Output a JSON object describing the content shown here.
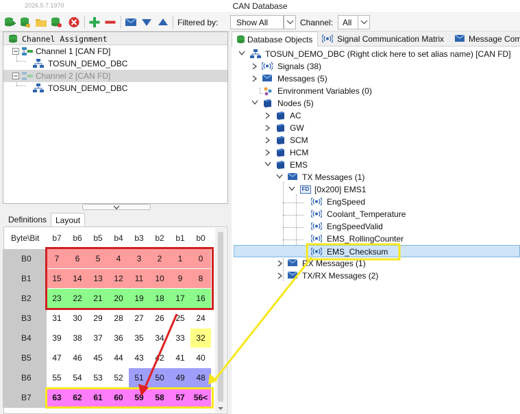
{
  "window": {
    "version": "2026.5.7.1970",
    "title": "CAN Database"
  },
  "toolbar": {
    "filtered_by_label": "Filtered by:",
    "filter_value": "Show All",
    "channel_label": "Channel:",
    "channel_value": "All",
    "icons": [
      "add-database-icon",
      "database-icon",
      "open-folder-icon",
      "delete-icon",
      "add-icon",
      "remove-icon",
      "message-icon",
      "move-down-icon",
      "move-up-icon"
    ]
  },
  "channel_assignment": {
    "header": "Channel Assignment",
    "items": [
      {
        "label": "Channel 1 [CAN FD]",
        "child": "TOSUN_DEMO_DBC"
      },
      {
        "label": "Channel 2 [CAN FD]",
        "child": "TOSUN_DEMO_DBC"
      }
    ]
  },
  "left_tabs": {
    "definitions": "Definitions",
    "layout": "Layout"
  },
  "layout_grid": {
    "corner": "Byte\\Bit",
    "bit_headers": [
      "b7",
      "b6",
      "b5",
      "b4",
      "b3",
      "b2",
      "b1",
      "b0"
    ],
    "rows": [
      {
        "label": "B0",
        "cells": [
          "7",
          "6",
          "5",
          "4",
          "3",
          "2",
          "1",
          "0"
        ]
      },
      {
        "label": "B1",
        "cells": [
          "15",
          "14",
          "13",
          "12",
          "11",
          "10",
          "9",
          "8"
        ]
      },
      {
        "label": "B2",
        "cells": [
          "23",
          "22",
          "21",
          "20",
          "19",
          "18",
          "17",
          "16"
        ]
      },
      {
        "label": "B3",
        "cells": [
          "31",
          "30",
          "29",
          "28",
          "27",
          "26",
          "25",
          "24"
        ]
      },
      {
        "label": "B4",
        "cells": [
          "39",
          "38",
          "37",
          "36",
          "35",
          "34",
          "33",
          "32"
        ]
      },
      {
        "label": "B5",
        "cells": [
          "47",
          "46",
          "45",
          "44",
          "43",
          "42",
          "41",
          "40"
        ]
      },
      {
        "label": "B6",
        "cells": [
          "55",
          "54",
          "53",
          "52",
          "51",
          "50",
          "49",
          "48"
        ]
      },
      {
        "label": "B7",
        "cells": [
          "63",
          "62",
          "61",
          "60",
          "59",
          "58",
          "57",
          "56<"
        ]
      }
    ],
    "colors": {
      "pink": "#ff9d9d",
      "green": "#8cfb8c",
      "yellow": "#ffff86",
      "blue": "#9f9ffb",
      "magenta": "#ff7cfa",
      "header_grey": "#c9c9c9"
    }
  },
  "right_tabs": [
    "Database Objects",
    "Signal Communication Matrix",
    "Message Com"
  ],
  "db_tree": {
    "root": "TOSUN_DEMO_DBC (Right click here to set alias name) [CAN FD]",
    "signals": "Signals (38)",
    "messages": "Messages (5)",
    "env_vars": "Environment Variables (0)",
    "nodes": "Nodes (5)",
    "node_list": [
      "AC",
      "GW",
      "SCM",
      "HCM",
      "EMS"
    ],
    "tx_messages": "TX Messages (1)",
    "ems1": "[0x200] EMS1",
    "fd_badge": "FD",
    "ems1_signals": [
      "EngSpeed",
      "Coolant_Temperature",
      "EngSpeedValid",
      "EMS_RollingCounter",
      "EMS_Checksum"
    ],
    "rx_messages": "RX Messages (1)",
    "txrx_messages": "TX/RX Messages (2)"
  }
}
